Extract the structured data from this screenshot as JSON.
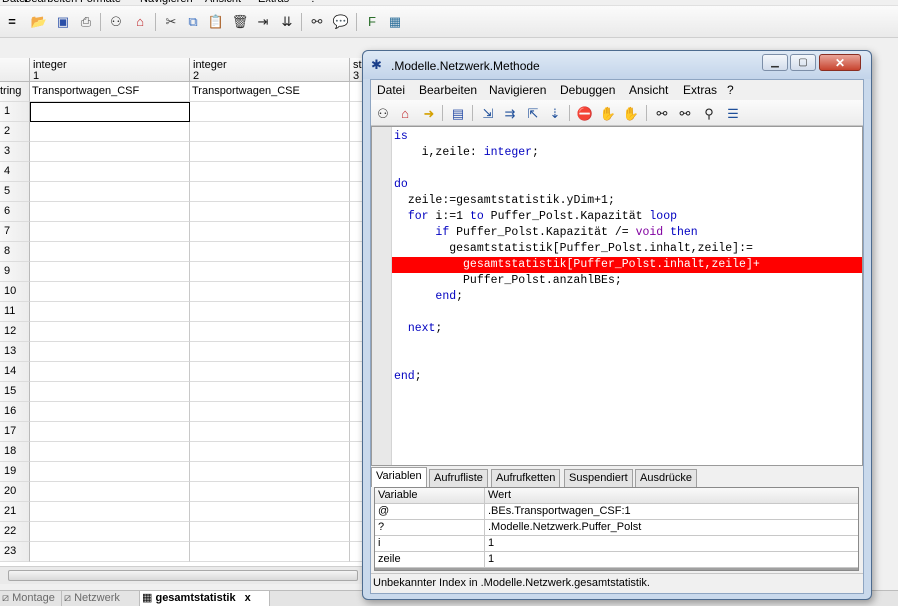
{
  "app": {
    "menu": [
      "Datei",
      "Bearbeiten",
      "Formate",
      "Navigieren",
      "Ansicht",
      "Extras",
      "?"
    ],
    "toolbar_icons": [
      "new-icon",
      "open-folder-icon",
      "save-icon",
      "print-icon",
      "find-in-tree-icon",
      "home-icon",
      "cut-icon",
      "copy-icon",
      "paste-icon",
      "delete-icon",
      "insert-row-icon",
      "insert-column-icon",
      "binoculars-icon",
      "speech-bubble-icon",
      "format-icon",
      "table-icon"
    ]
  },
  "grid": {
    "columns": [
      {
        "type": "integer",
        "index": "1",
        "name": "Transportwagen_CSF"
      },
      {
        "type": "integer",
        "index": "2",
        "name": "Transportwagen_CSE"
      },
      {
        "type": "st",
        "index": "3",
        "name": ""
      }
    ],
    "row_header_label": "tring",
    "rows": [
      "1",
      "2",
      "3",
      "4",
      "5",
      "6",
      "7",
      "8",
      "9",
      "10",
      "11",
      "12",
      "13",
      "14",
      "15",
      "16",
      "17",
      "18",
      "19",
      "20",
      "21",
      "22",
      "23"
    ]
  },
  "bottom_tabs": [
    {
      "label": "Montage",
      "active": false
    },
    {
      "label": "Netzwerk",
      "active": false
    },
    {
      "label": "gesamtstatistik",
      "active": true,
      "close": "x"
    }
  ],
  "window": {
    "title": ".Modelle.Netzwerk.Methode",
    "menu": [
      "Datei",
      "Bearbeiten",
      "Navigieren",
      "Debuggen",
      "Ansicht",
      "Extras",
      "?"
    ],
    "code_lines": [
      {
        "indent": "",
        "tokens": [
          {
            "t": "is",
            "c": "kw"
          }
        ]
      },
      {
        "indent": "    ",
        "tokens": [
          {
            "t": "i,zeile: ",
            "c": "plain"
          },
          {
            "t": "integer",
            "c": "kw"
          },
          {
            "t": ";",
            "c": "plain"
          }
        ]
      },
      {
        "indent": "",
        "tokens": []
      },
      {
        "indent": "",
        "tokens": [
          {
            "t": "do",
            "c": "kw"
          }
        ]
      },
      {
        "indent": "  ",
        "tokens": [
          {
            "t": "zeile:=gesamtstatistik.yDim+1;",
            "c": "plain"
          }
        ]
      },
      {
        "indent": "  ",
        "tokens": [
          {
            "t": "for",
            "c": "kw"
          },
          {
            "t": " i:=1 ",
            "c": "plain"
          },
          {
            "t": "to",
            "c": "kw"
          },
          {
            "t": " Puffer_Polst.Kapazität ",
            "c": "plain"
          },
          {
            "t": "loop",
            "c": "kw"
          }
        ]
      },
      {
        "indent": "      ",
        "tokens": [
          {
            "t": "if",
            "c": "kw"
          },
          {
            "t": " Puffer_Polst.Kapazität /= ",
            "c": "plain"
          },
          {
            "t": "void",
            "c": "kw2"
          },
          {
            "t": " ",
            "c": "plain"
          },
          {
            "t": "then",
            "c": "kw"
          }
        ]
      },
      {
        "indent": "        ",
        "tokens": [
          {
            "t": "gesamtstatistik[Puffer_Polst.inhalt,zeile]:=",
            "c": "plain"
          }
        ]
      },
      {
        "indent": "          ",
        "highlight": true,
        "tokens": [
          {
            "t": "gesamtstatistik[Puffer_Polst.inhalt,zeile]+",
            "c": "plain"
          }
        ]
      },
      {
        "indent": "          ",
        "tokens": [
          {
            "t": "Puffer_Polst.anzahlBEs;",
            "c": "plain"
          }
        ]
      },
      {
        "indent": "      ",
        "tokens": [
          {
            "t": "end",
            "c": "kw"
          },
          {
            "t": ";",
            "c": "plain"
          }
        ]
      },
      {
        "indent": "",
        "tokens": []
      },
      {
        "indent": "  ",
        "tokens": [
          {
            "t": "next",
            "c": "kw"
          },
          {
            "t": ";",
            "c": "plain"
          }
        ]
      },
      {
        "indent": "",
        "tokens": []
      },
      {
        "indent": "",
        "tokens": []
      },
      {
        "indent": "",
        "tokens": [
          {
            "t": "end",
            "c": "kw"
          },
          {
            "t": ";",
            "c": "plain"
          }
        ]
      }
    ],
    "tabs": [
      {
        "label": "Variablen",
        "active": true
      },
      {
        "label": "Aufrufliste",
        "active": false
      },
      {
        "label": "Aufrufketten",
        "active": false
      },
      {
        "label": "Suspendiert",
        "active": false
      },
      {
        "label": "Ausdrücke",
        "active": false
      }
    ],
    "variables": {
      "headers": [
        "Variable",
        "Wert"
      ],
      "rows": [
        {
          "name": "@",
          "value": ".BEs.Transportwagen_CSF:1"
        },
        {
          "name": "?",
          "value": ".Modelle.Netzwerk.Puffer_Polst"
        },
        {
          "name": "i",
          "value": "1"
        },
        {
          "name": "zeile",
          "value": "1"
        }
      ]
    },
    "status": "Unbekannter Index in .Modelle.Netzwerk.gesamtstatistik.",
    "toolbar_icons": [
      "binoculars-icon",
      "home-icon",
      "arrow-right-icon",
      "window-icon",
      "step-into-icon",
      "step-over-icon",
      "step-out-icon",
      "run-to-icon",
      "breakpoint-icon",
      "hand-icon",
      "stop-hand-icon",
      "find-icon",
      "find-next-icon",
      "find-replace-icon",
      "list-icon"
    ]
  },
  "colors": {
    "error_highlight": "#ff0000",
    "keyword": "#0000c0",
    "void_keyword": "#8000a0"
  }
}
